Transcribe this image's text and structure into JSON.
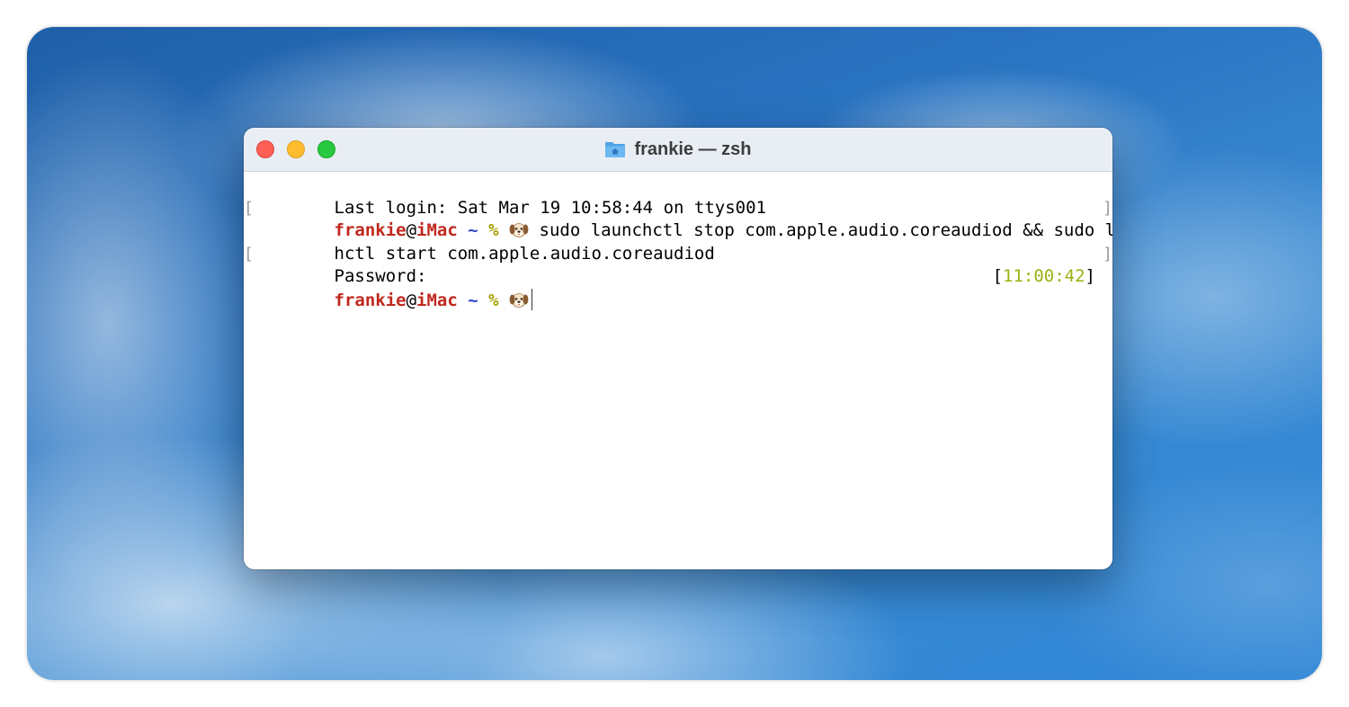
{
  "window": {
    "title": "frankie — zsh",
    "title_icon": "home-folder-icon"
  },
  "terminal": {
    "last_login": "Last login: Sat Mar 19 10:58:44 on ttys001",
    "prompt": {
      "user": "frankie",
      "at": "@",
      "host": "iMac",
      "path": "~",
      "symbol": "%",
      "emoji": "dog-face-icon"
    },
    "command_line_1": "sudo launchctl stop com.apple.audio.coreaudiod && sudo launc",
    "command_line_2": "hctl start com.apple.audio.coreaudiod",
    "password_prompt": "Password:",
    "mark_open": "[",
    "mark_close": "]",
    "rprompt_open": "[",
    "rprompt_time": "11:00:42",
    "rprompt_close": "]"
  },
  "colors": {
    "user_host": "#c0281e",
    "tilde": "#2f47c7",
    "percent": "#a5a000",
    "clock": "#9db112",
    "close_button": "#fe5f57",
    "minimize_button": "#febc2e",
    "zoom_button": "#28c840"
  }
}
